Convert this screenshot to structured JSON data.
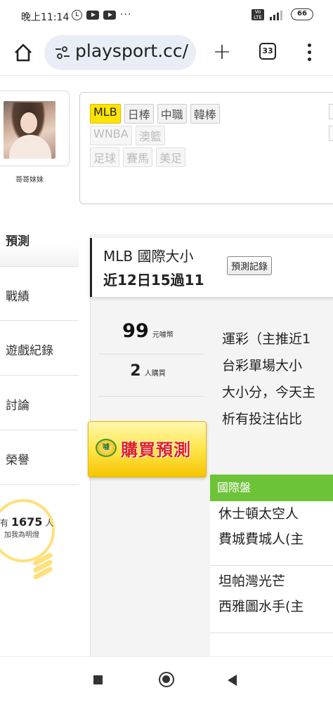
{
  "status_bar": {
    "time": "晚上11:14",
    "dots": "···",
    "volte": "VoLTE",
    "network": "4G",
    "battery": "66"
  },
  "browser": {
    "url": "playsport.cc/",
    "tab_count": "33",
    "new_tab": "+"
  },
  "profile": {
    "name": "哥哥妹妹"
  },
  "sports": {
    "row1": [
      "MLB",
      "日棒",
      "中職",
      "韓棒"
    ],
    "row2": [
      "WNBA",
      "澳籃"
    ],
    "row3": [
      "足球",
      "賽馬",
      "美足"
    ],
    "active": "MLB"
  },
  "sidebar": {
    "items": [
      {
        "label": "預測",
        "active": true
      },
      {
        "label": "戰績"
      },
      {
        "label": "遊戲紀錄"
      },
      {
        "label": "討論"
      },
      {
        "label": "榮譽"
      }
    ],
    "fans_prefix": "有",
    "fans_count": "1675",
    "fans_suffix": "人",
    "fans_caption": "加我為明燈"
  },
  "prediction": {
    "title": "MLB 國際大小",
    "record": "近12日15過11",
    "record_button": "預測記錄",
    "price": "99",
    "price_unit": "元噱幣",
    "buyers": "2",
    "buyers_unit": "人購買",
    "buy_button": "購買預測",
    "buy_coin": "噱",
    "description": [
      "運彩（主推近1",
      "台彩單場大小",
      "大小分，今天主",
      "析有投注佔比"
    ]
  },
  "international": {
    "header": "國際盤",
    "matches": [
      {
        "away": "休士頓太空人",
        "home": "費城費城人(主"
      },
      {
        "away": "坦帕灣光芒",
        "home": "西雅圖水手(主"
      }
    ]
  },
  "colors": {
    "active_tag": "#ffe400",
    "intl_header": "#6cc338",
    "buy_text": "#e02020",
    "bulb": "#ffe07a"
  }
}
